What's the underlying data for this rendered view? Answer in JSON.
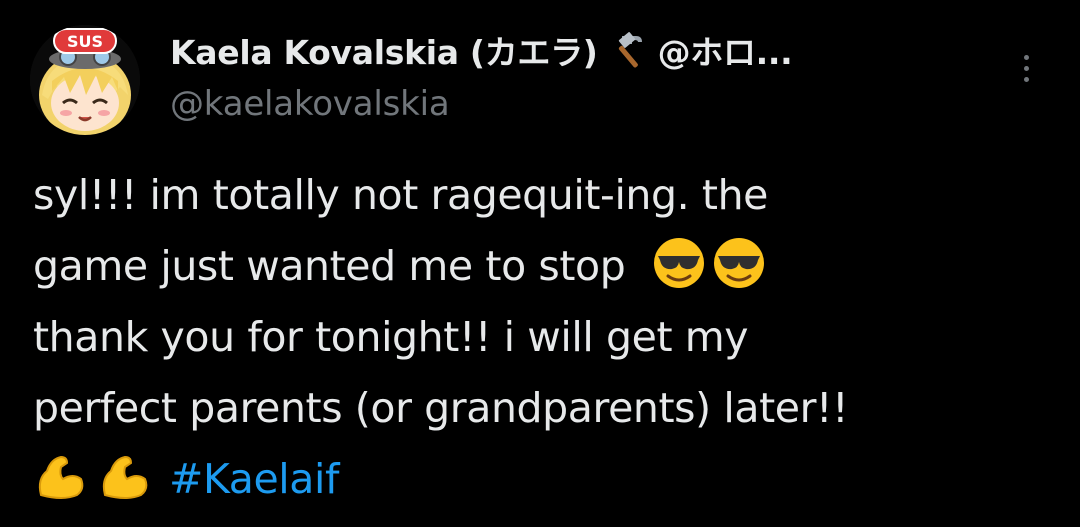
{
  "tweet": {
    "display_name": "Kaela Kovalskia (カエラ)",
    "name_suffix": "@ホロ...",
    "username": "@kaelakovalskia",
    "avatar_badge": "SUS",
    "name_emoji": "hammer-icon",
    "body": {
      "line1": "syl!!! im totally not ragequit-ing. the",
      "line2": "game just wanted me to stop",
      "line2_emojis": [
        "smiling-face-with-sunglasses-icon",
        "smiling-face-with-sunglasses-icon"
      ],
      "line3": "thank you for tonight!! i will get my",
      "line4": "perfect parents (or grandparents) later!!",
      "line5_emojis": [
        "flexed-biceps-icon",
        "flexed-biceps-icon"
      ],
      "hashtag": "#Kaelaif"
    }
  },
  "colors": {
    "background": "#000000",
    "primary_text": "#e7e9ea",
    "secondary_text": "#71767b",
    "link": "#1d9bf0"
  }
}
